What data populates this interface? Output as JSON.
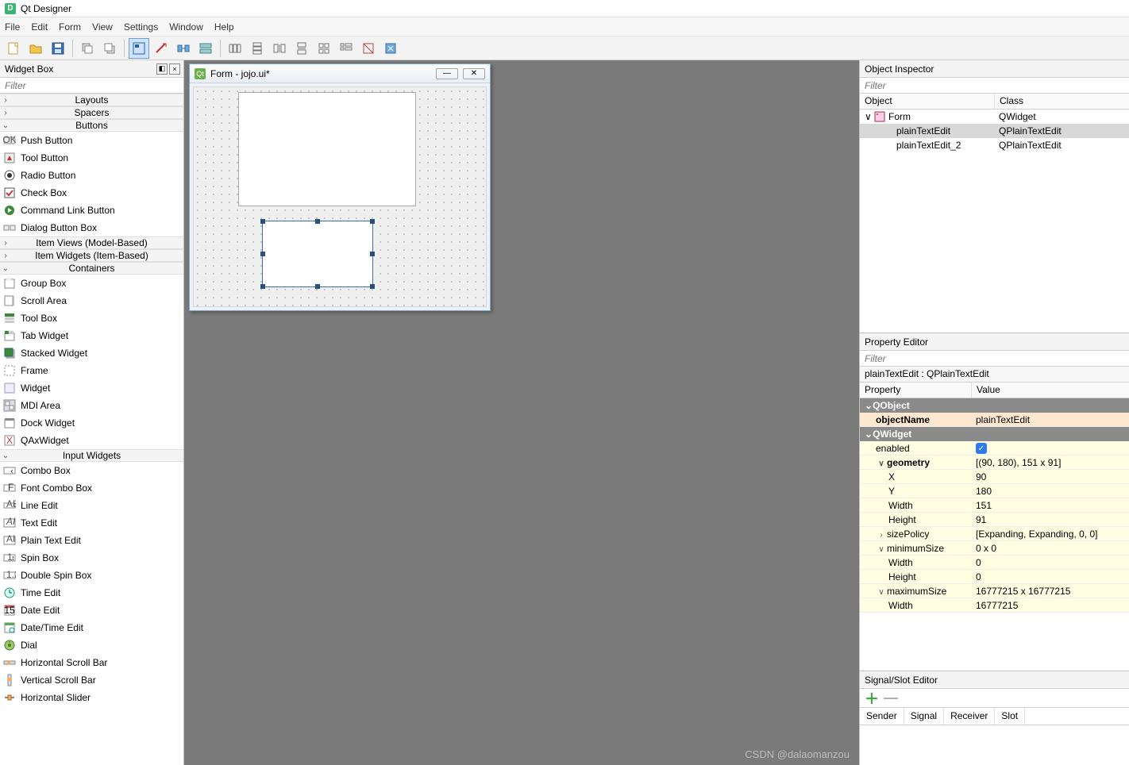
{
  "app": {
    "title": "Qt Designer"
  },
  "menu": [
    "File",
    "Edit",
    "Form",
    "View",
    "Settings",
    "Window",
    "Help"
  ],
  "widgetBox": {
    "title": "Widget Box",
    "filterPlaceholder": "Filter",
    "cats": {
      "layouts": "Layouts",
      "spacers": "Spacers",
      "buttons": "Buttons",
      "itemViews": "Item Views (Model-Based)",
      "itemWidgets": "Item Widgets (Item-Based)",
      "containers": "Containers",
      "inputWidgets": "Input Widgets"
    },
    "buttons": [
      "Push Button",
      "Tool Button",
      "Radio Button",
      "Check Box",
      "Command Link Button",
      "Dialog Button Box"
    ],
    "containers": [
      "Group Box",
      "Scroll Area",
      "Tool Box",
      "Tab Widget",
      "Stacked Widget",
      "Frame",
      "Widget",
      "MDI Area",
      "Dock Widget",
      "QAxWidget"
    ],
    "inputs": [
      "Combo Box",
      "Font Combo Box",
      "Line Edit",
      "Text Edit",
      "Plain Text Edit",
      "Spin Box",
      "Double Spin Box",
      "Time Edit",
      "Date Edit",
      "Date/Time Edit",
      "Dial",
      "Horizontal Scroll Bar",
      "Vertical Scroll Bar",
      "Horizontal Slider"
    ]
  },
  "form": {
    "title": "Form - jojo.ui*"
  },
  "objectInspector": {
    "title": "Object Inspector",
    "filterPlaceholder": "Filter",
    "cols": {
      "object": "Object",
      "class": "Class"
    },
    "rows": [
      {
        "object": "Form",
        "class": "QWidget",
        "indent": 0,
        "expand": "∨",
        "icon": "form"
      },
      {
        "object": "plainTextEdit",
        "class": "QPlainTextEdit",
        "indent": 1,
        "sel": true
      },
      {
        "object": "plainTextEdit_2",
        "class": "QPlainTextEdit",
        "indent": 1
      }
    ]
  },
  "propertyEditor": {
    "title": "Property Editor",
    "filterPlaceholder": "Filter",
    "objLine": "plainTextEdit : QPlainTextEdit",
    "cols": {
      "property": "Property",
      "value": "Value"
    },
    "groups": {
      "qobject": "QObject",
      "qwidget": "QWidget"
    },
    "rows": [
      {
        "g": "qobject"
      },
      {
        "p": "objectName",
        "v": "plainTextEdit",
        "hl": true,
        "bold": true
      },
      {
        "g": "qwidget"
      },
      {
        "p": "enabled",
        "v": "__check__",
        "y": true
      },
      {
        "p": "geometry",
        "v": "[(90, 180), 151 x 91]",
        "y": true,
        "exp": "∨",
        "bold": true
      },
      {
        "p": "X",
        "v": "90",
        "y": true,
        "sub": 1
      },
      {
        "p": "Y",
        "v": "180",
        "y": true,
        "sub": 1
      },
      {
        "p": "Width",
        "v": "151",
        "y": true,
        "sub": 1
      },
      {
        "p": "Height",
        "v": "91",
        "y": true,
        "sub": 1
      },
      {
        "p": "sizePolicy",
        "v": "[Expanding, Expanding, 0, 0]",
        "y": true,
        "exp": "›"
      },
      {
        "p": "minimumSize",
        "v": "0 x 0",
        "y": true,
        "exp": "∨"
      },
      {
        "p": "Width",
        "v": "0",
        "y": true,
        "sub": 1
      },
      {
        "p": "Height",
        "v": "0",
        "y": true,
        "sub": 1
      },
      {
        "p": "maximumSize",
        "v": "16777215 x 16777215",
        "y": true,
        "exp": "∨"
      },
      {
        "p": "Width",
        "v": "16777215",
        "y": true,
        "sub": 1
      }
    ]
  },
  "signalSlot": {
    "title": "Signal/Slot Editor",
    "cols": [
      "Sender",
      "Signal",
      "Receiver",
      "Slot"
    ]
  },
  "watermark": "CSDN @dalaomanzou"
}
